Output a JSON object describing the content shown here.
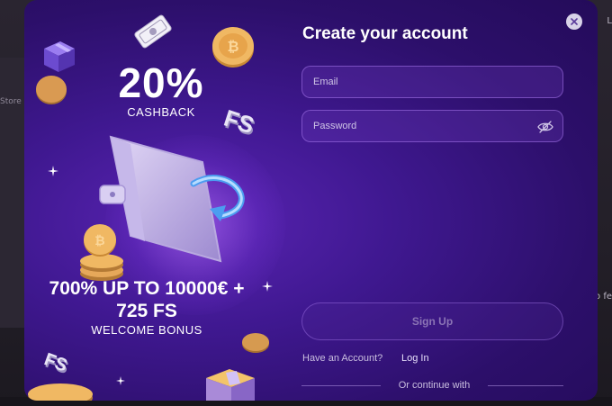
{
  "background": {
    "left_label": "Store",
    "right_top_label": "L",
    "right_label": "o fe"
  },
  "promo": {
    "headline": "20%",
    "headline_sub": "CASHBACK",
    "bonus_amount": "700% UP TO 10000€ +",
    "bonus_fs": "725 FS",
    "bonus_label": "WELCOME BONUS",
    "fs_badge": "FS"
  },
  "form": {
    "title": "Create your account",
    "email_placeholder": "Email",
    "password_placeholder": "Password",
    "signup_label": "Sign Up",
    "have_account": "Have an Account?",
    "login_label": "Log In",
    "continue_with": "Or continue with"
  },
  "colors": {
    "modal_bg": "#3f1890",
    "accent": "#a578eb",
    "text": "#ffffff"
  },
  "icons": {
    "close": "close-icon",
    "eye_off": "eye-off-icon"
  }
}
